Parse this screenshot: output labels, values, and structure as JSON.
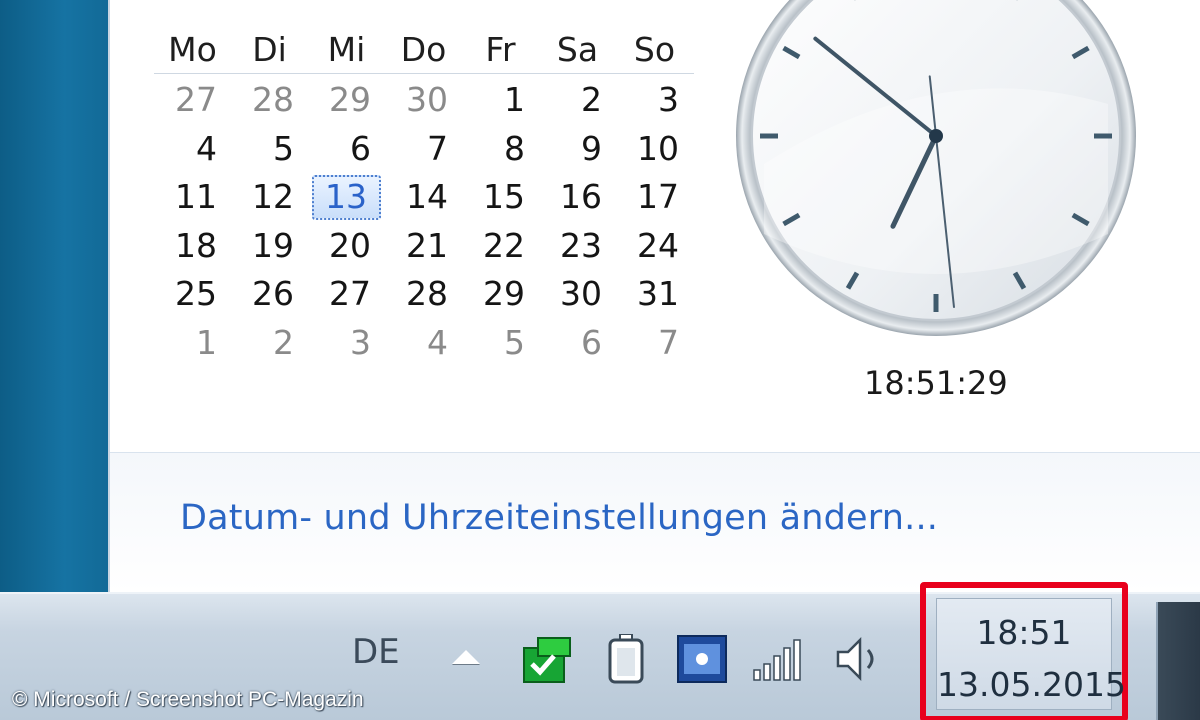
{
  "calendar": {
    "weekdays": [
      "Mo",
      "Di",
      "Mi",
      "Do",
      "Fr",
      "Sa",
      "So"
    ],
    "days": [
      {
        "d": "27",
        "other": true
      },
      {
        "d": "28",
        "other": true
      },
      {
        "d": "29",
        "other": true
      },
      {
        "d": "30",
        "other": true
      },
      {
        "d": "1"
      },
      {
        "d": "2"
      },
      {
        "d": "3"
      },
      {
        "d": "4"
      },
      {
        "d": "5"
      },
      {
        "d": "6"
      },
      {
        "d": "7"
      },
      {
        "d": "8"
      },
      {
        "d": "9"
      },
      {
        "d": "10"
      },
      {
        "d": "11"
      },
      {
        "d": "12"
      },
      {
        "d": "13",
        "today": true
      },
      {
        "d": "14"
      },
      {
        "d": "15"
      },
      {
        "d": "16"
      },
      {
        "d": "17"
      },
      {
        "d": "18"
      },
      {
        "d": "19"
      },
      {
        "d": "20"
      },
      {
        "d": "21"
      },
      {
        "d": "22"
      },
      {
        "d": "23"
      },
      {
        "d": "24"
      },
      {
        "d": "25"
      },
      {
        "d": "26"
      },
      {
        "d": "27"
      },
      {
        "d": "28"
      },
      {
        "d": "29"
      },
      {
        "d": "30"
      },
      {
        "d": "31"
      },
      {
        "d": "1",
        "other": true
      },
      {
        "d": "2",
        "other": true
      },
      {
        "d": "3",
        "other": true
      },
      {
        "d": "4",
        "other": true
      },
      {
        "d": "5",
        "other": true
      },
      {
        "d": "6",
        "other": true
      },
      {
        "d": "7",
        "other": true
      }
    ]
  },
  "clock": {
    "hours": 18,
    "minutes": 51,
    "seconds": 29,
    "digital": "18:51:29"
  },
  "settings_link": "Datum- und Uhrzeiteinstellungen ändern...",
  "taskbar": {
    "language": "DE",
    "time": "18:51",
    "date": "13.05.2015",
    "tray_icons": [
      "action-center-flag-icon",
      "battery-icon",
      "app-tray-icon",
      "network-signal-icon",
      "speaker-icon"
    ]
  },
  "copyright": "© Microsoft / Screenshot PC-Magazin",
  "colors": {
    "highlight_box": "#e8001c",
    "link": "#2b66c4",
    "today": "#2a62c9"
  }
}
